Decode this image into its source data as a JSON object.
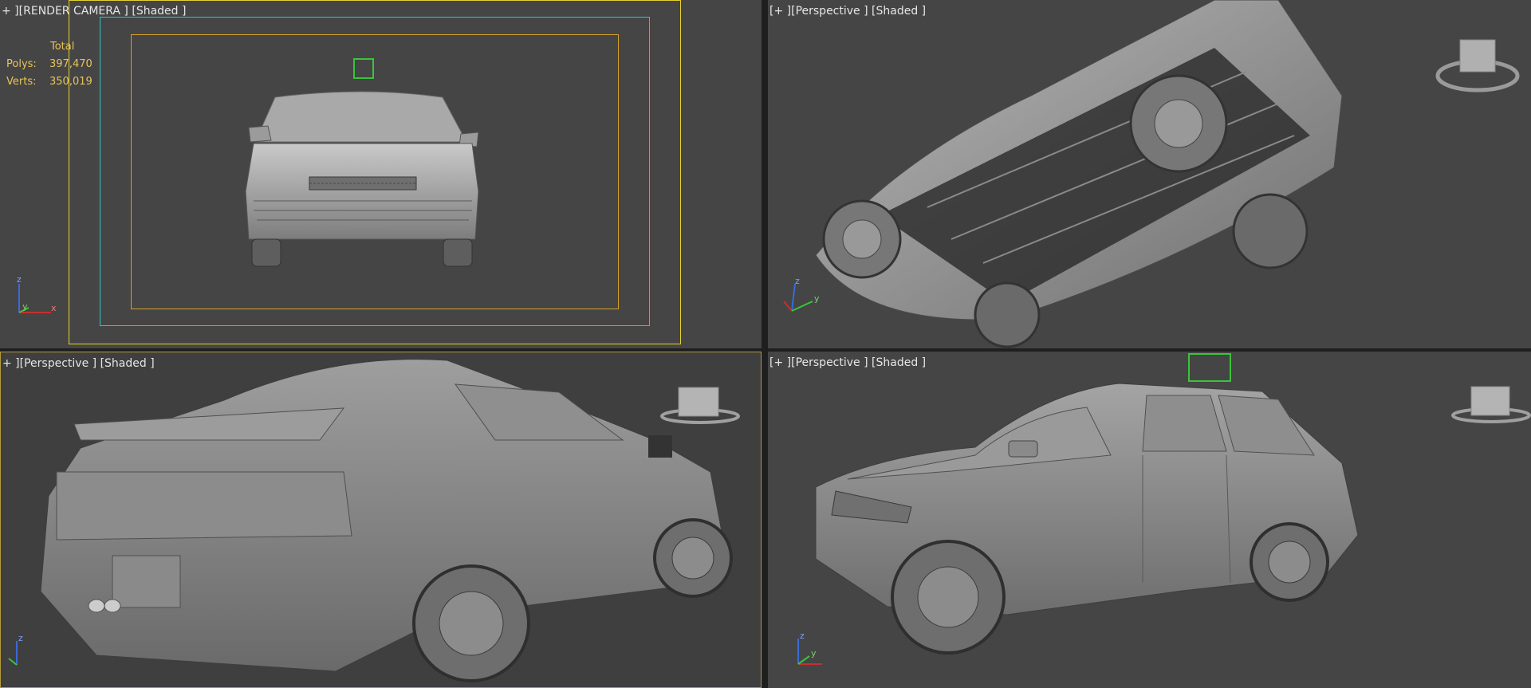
{
  "viewports": {
    "top_left": {
      "label_plus": "+ ]",
      "label_view": "[RENDER CAMERA ]",
      "label_shading": "[Shaded ]",
      "stats": {
        "header": "Total",
        "polys_label": "Polys:",
        "polys_value": "397,470",
        "verts_label": "Verts:",
        "verts_value": "350,019"
      }
    },
    "top_right": {
      "label_plus": "[+ ]",
      "label_view": "[Perspective ]",
      "label_shading": "[Shaded ]"
    },
    "bottom_left": {
      "label_plus": "+ ]",
      "label_view": "[Perspective ]",
      "label_shading": "[Shaded ]"
    },
    "bottom_right": {
      "label_plus": "[+ ]",
      "label_view": "[Perspective ]",
      "label_shading": "[Shaded ]"
    }
  },
  "axis_labels": {
    "z": "z",
    "y": "y",
    "x": "x"
  },
  "colors": {
    "viewport_bg": "#454545",
    "active_border": "#b59a3a",
    "safe_frame_outer": "#e5d12f",
    "safe_frame_action": "#2fc4c8",
    "safe_frame_title": "#d6a128",
    "stats_text": "#e8c35a",
    "selection_green": "#3ac43a"
  },
  "icons": {
    "viewcube": "viewcube-icon",
    "axis_tripod": "axis-tripod-icon"
  }
}
